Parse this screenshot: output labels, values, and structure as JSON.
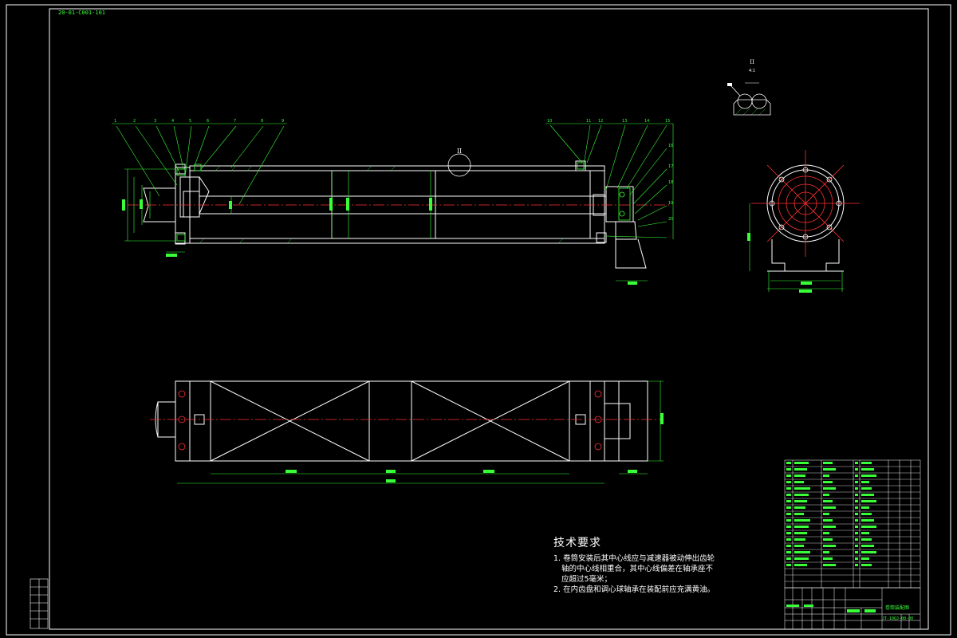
{
  "drawing": {
    "stamp": "20-01-C001-101",
    "detail_label": "II",
    "detail_scale": "II\n4:1",
    "part_numbers_top_left": [
      "1",
      "2",
      "3",
      "4",
      "5",
      "6",
      "7",
      "8",
      "9"
    ],
    "part_numbers_top_right": [
      "10",
      "11",
      "12",
      "13",
      "14",
      "15",
      "16",
      "17",
      "18",
      "19",
      "20"
    ]
  },
  "technical_requirements": {
    "title": "技术要求",
    "items": [
      "1. 卷筒安装后其中心线应与减速器被动伸出齿轮",
      "轴的中心线相重合，其中心线偏差在轴承座不",
      "应超过5毫米；",
      "2. 在内齿盘和调心球轴承在装配前应充满黄油。"
    ]
  },
  "title_block": {
    "name": "卷筒装配图",
    "code": "JT-10QJ-00-00"
  },
  "colors": {
    "background": "#000000",
    "lines": "#ffffff",
    "dimensions": "#39ff39",
    "centerlines": "#ff3030",
    "hidden": "#ff40ff"
  }
}
